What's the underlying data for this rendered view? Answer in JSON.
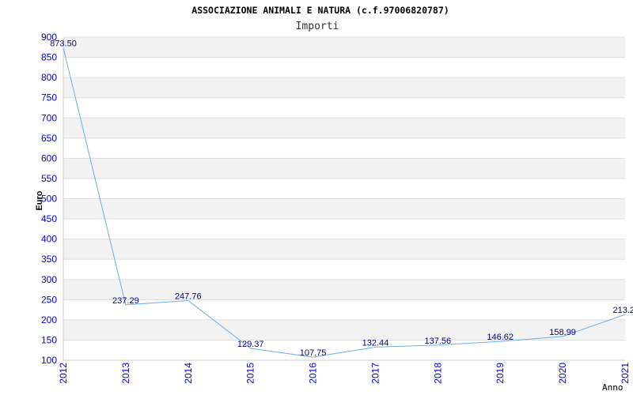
{
  "chart_data": {
    "type": "line",
    "title": "ASSOCIAZIONE ANIMALI E NATURA (c.f.97006820787)",
    "subtitle": "Importi",
    "xlabel": "Anno",
    "ylabel": "Euro",
    "ylim": [
      100,
      900
    ],
    "yticks": [
      "100",
      "150",
      "200",
      "250",
      "300",
      "350",
      "400",
      "450",
      "500",
      "550",
      "600",
      "650",
      "700",
      "750",
      "800",
      "850",
      "900"
    ],
    "categories": [
      "2012",
      "2013",
      "2014",
      "2015",
      "2016",
      "2017",
      "2018",
      "2019",
      "2020",
      "2021"
    ],
    "series": [
      {
        "values": [
          873.5,
          237.29,
          247.76,
          129.37,
          107.75,
          132.44,
          137.56,
          146.62,
          158.99,
          213.2
        ],
        "labels": [
          "873.50",
          "237.29",
          "247.76",
          "129.37",
          "107.75",
          "132.44",
          "137.56",
          "146.62",
          "158.99",
          "213.2"
        ]
      }
    ],
    "grid": true,
    "colors": {
      "line": "#6aaee8",
      "tick": "#0000cc",
      "label": "#000080",
      "band": "#f2f2f2",
      "grid": "#dddddd"
    }
  }
}
